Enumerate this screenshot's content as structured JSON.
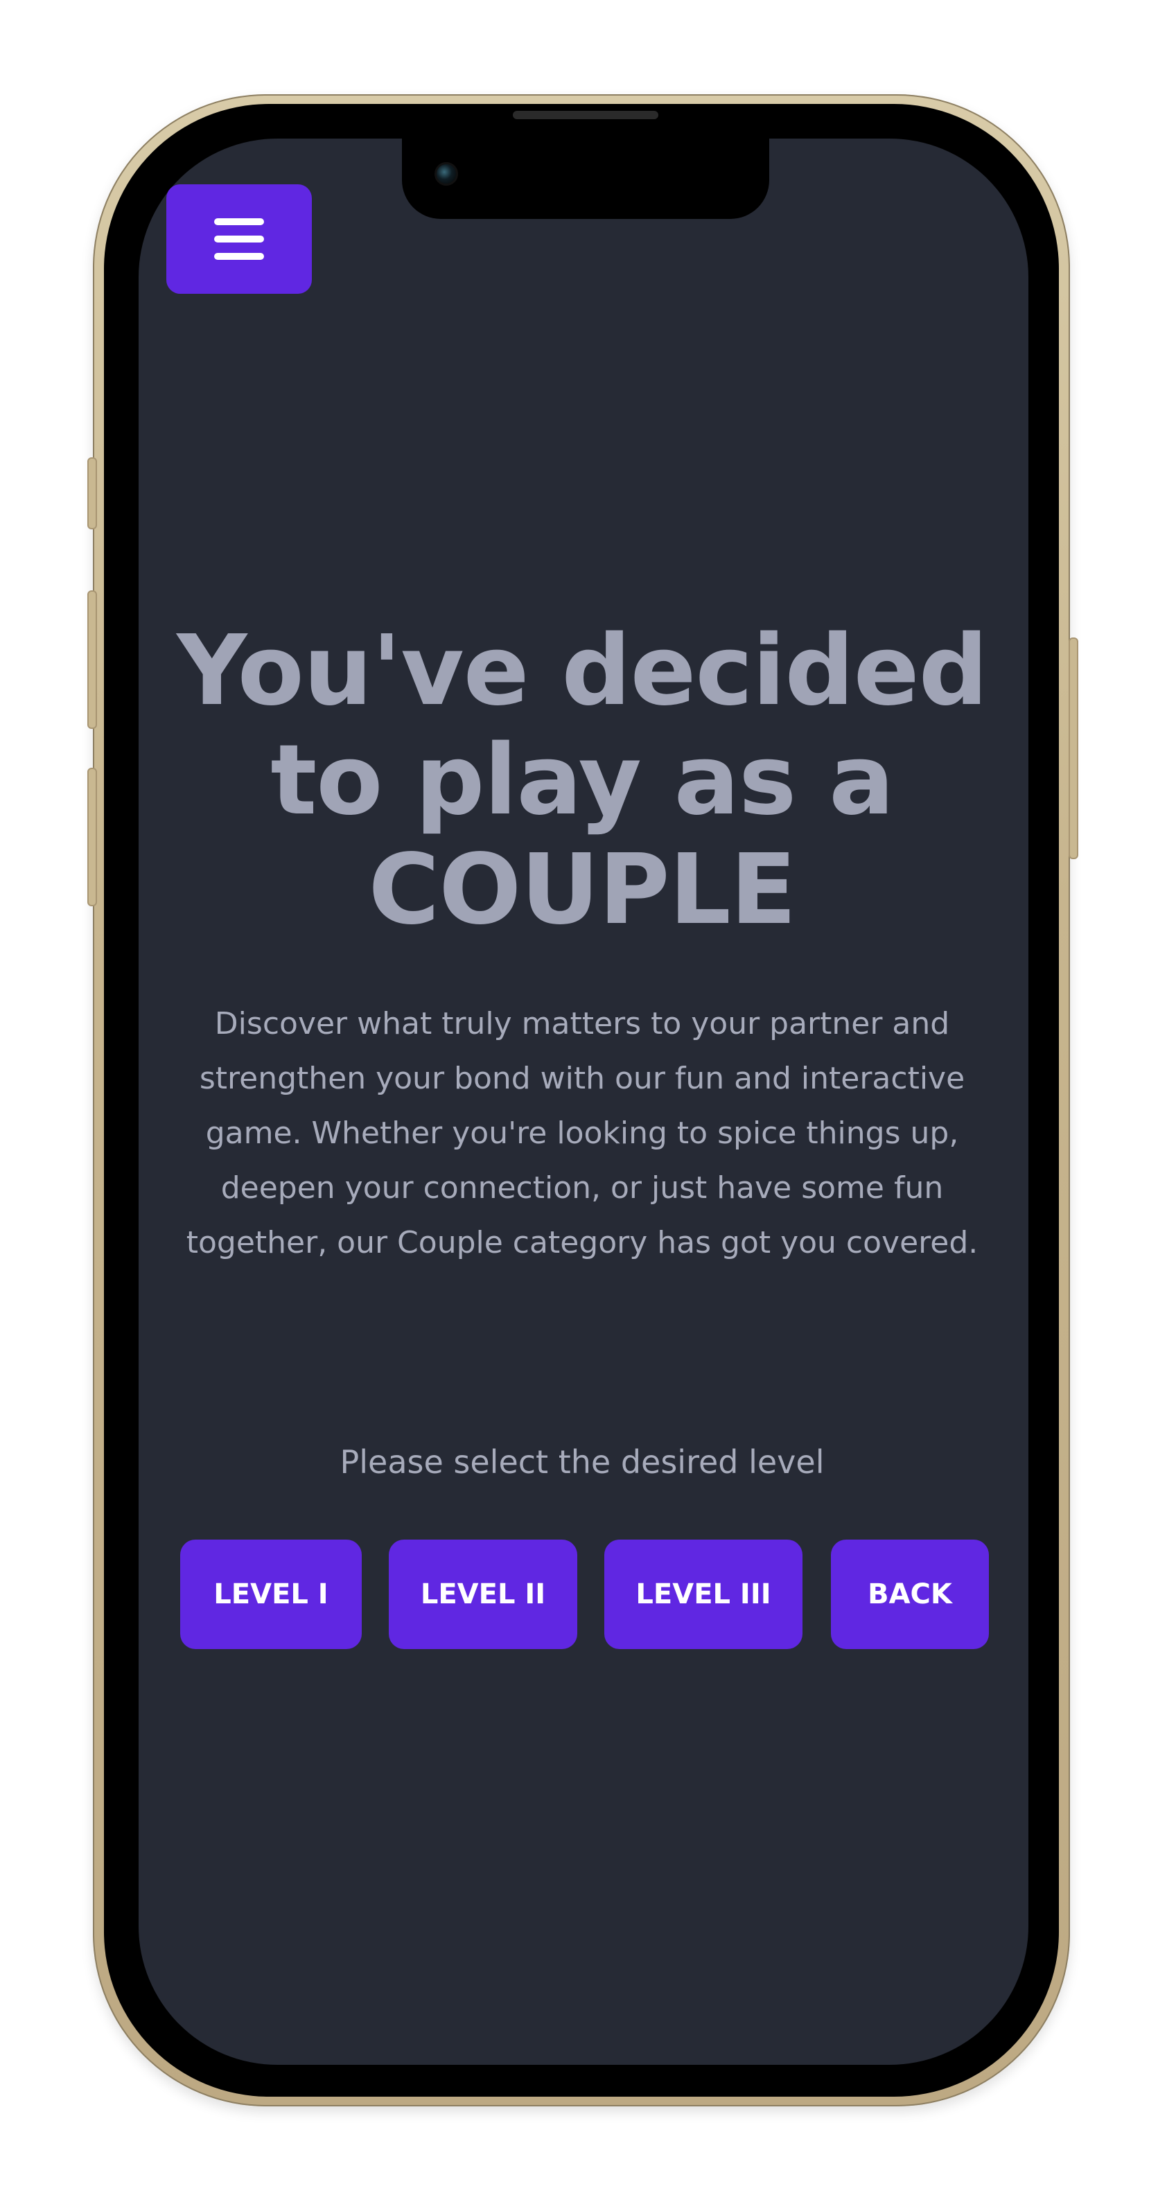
{
  "menu": {
    "icon": "hamburger-icon"
  },
  "hero": {
    "line1": "You've decided",
    "line2": "to play as a",
    "line3": "COUPLE"
  },
  "description": "Discover what truly matters to your partner and strengthen your bond with our fun and interactive game. Whether you're looking to spice things up, deepen your connection, or just have some fun together, our Couple category has got you covered.",
  "prompt": "Please select the desired level",
  "buttons": {
    "level1": "LEVEL I",
    "level2": "LEVEL II",
    "level3": "LEVEL III",
    "back": "BACK"
  },
  "colors": {
    "background": "#262a35",
    "accent": "#6027e2",
    "headline": "#a0a4b6",
    "body_text": "#a7abbb"
  }
}
